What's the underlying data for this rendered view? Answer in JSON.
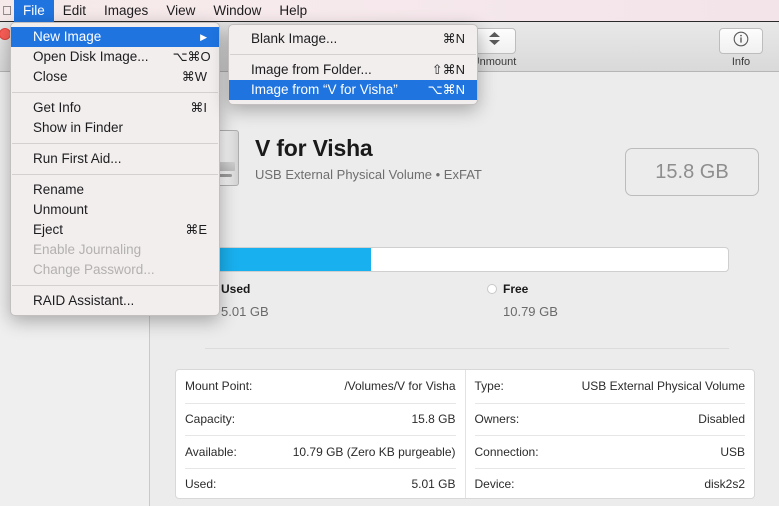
{
  "menubar": {
    "apple_icon": "apple-logo",
    "items": [
      {
        "label": "File",
        "active": true
      },
      {
        "label": "Edit",
        "active": false
      },
      {
        "label": "Images",
        "active": false
      },
      {
        "label": "View",
        "active": false
      },
      {
        "label": "Window",
        "active": false
      },
      {
        "label": "Help",
        "active": false
      }
    ]
  },
  "file_menu": {
    "items": [
      {
        "label": "New Image",
        "shortcut": "",
        "submenu": true,
        "highlighted": true,
        "disabled": false
      },
      {
        "label": "Open Disk Image...",
        "shortcut": "⌥⌘O",
        "submenu": false,
        "highlighted": false,
        "disabled": false
      },
      {
        "label": "Close",
        "shortcut": "⌘W",
        "submenu": false,
        "highlighted": false,
        "disabled": false
      },
      {
        "separator": true
      },
      {
        "label": "Get Info",
        "shortcut": "⌘I",
        "submenu": false,
        "highlighted": false,
        "disabled": false
      },
      {
        "label": "Show in Finder",
        "shortcut": "",
        "submenu": false,
        "highlighted": false,
        "disabled": false
      },
      {
        "separator": true
      },
      {
        "label": "Run First Aid...",
        "shortcut": "",
        "submenu": false,
        "highlighted": false,
        "disabled": false
      },
      {
        "separator": true
      },
      {
        "label": "Rename",
        "shortcut": "",
        "submenu": false,
        "highlighted": false,
        "disabled": false
      },
      {
        "label": "Unmount",
        "shortcut": "",
        "submenu": false,
        "highlighted": false,
        "disabled": false
      },
      {
        "label": "Eject",
        "shortcut": "⌘E",
        "submenu": false,
        "highlighted": false,
        "disabled": false
      },
      {
        "label": "Enable Journaling",
        "shortcut": "",
        "submenu": false,
        "highlighted": false,
        "disabled": true
      },
      {
        "label": "Change Password...",
        "shortcut": "",
        "submenu": false,
        "highlighted": false,
        "disabled": true
      },
      {
        "separator": true
      },
      {
        "label": "RAID Assistant...",
        "shortcut": "",
        "submenu": false,
        "highlighted": false,
        "disabled": false
      }
    ]
  },
  "new_image_submenu": {
    "items": [
      {
        "label": "Blank Image...",
        "shortcut": "⌘N",
        "highlighted": false,
        "disabled": false
      },
      {
        "separator": true
      },
      {
        "label": "Image from Folder...",
        "shortcut": "⇧⌘N",
        "highlighted": false,
        "disabled": false
      },
      {
        "label": "Image from “V for Visha”",
        "shortcut": "⌥⌘N",
        "highlighted": true,
        "disabled": false
      }
    ]
  },
  "toolbar": {
    "unmount_label": "Unmount",
    "unmount_icon": "eject-icon",
    "info_label": "Info",
    "info_icon": "info-circle-icon"
  },
  "volume": {
    "icon": "external-drive-icon",
    "name": "V for Visha",
    "subtitle": "USB External Physical Volume • ExFAT",
    "capacity_pill": "15.8 GB"
  },
  "capacity_bar": {
    "used_percent": 31.7,
    "used_color": "#19b0ef",
    "free_color": "#ffffff",
    "legend": [
      {
        "title": "Used",
        "value": "5.01 GB",
        "color": "#19b0ef"
      },
      {
        "title": "Free",
        "value": "10.79 GB",
        "color": "#ffffff"
      }
    ]
  },
  "info_table": {
    "left": [
      {
        "key": "Mount Point:",
        "value": "/Volumes/V for Visha"
      },
      {
        "key": "Capacity:",
        "value": "15.8 GB"
      },
      {
        "key": "Available:",
        "value": "10.79 GB (Zero KB purgeable)"
      },
      {
        "key": "Used:",
        "value": "5.01 GB"
      }
    ],
    "right": [
      {
        "key": "Type:",
        "value": "USB External Physical Volume"
      },
      {
        "key": "Owners:",
        "value": "Disabled"
      },
      {
        "key": "Connection:",
        "value": "USB"
      },
      {
        "key": "Device:",
        "value": "disk2s2"
      }
    ]
  }
}
